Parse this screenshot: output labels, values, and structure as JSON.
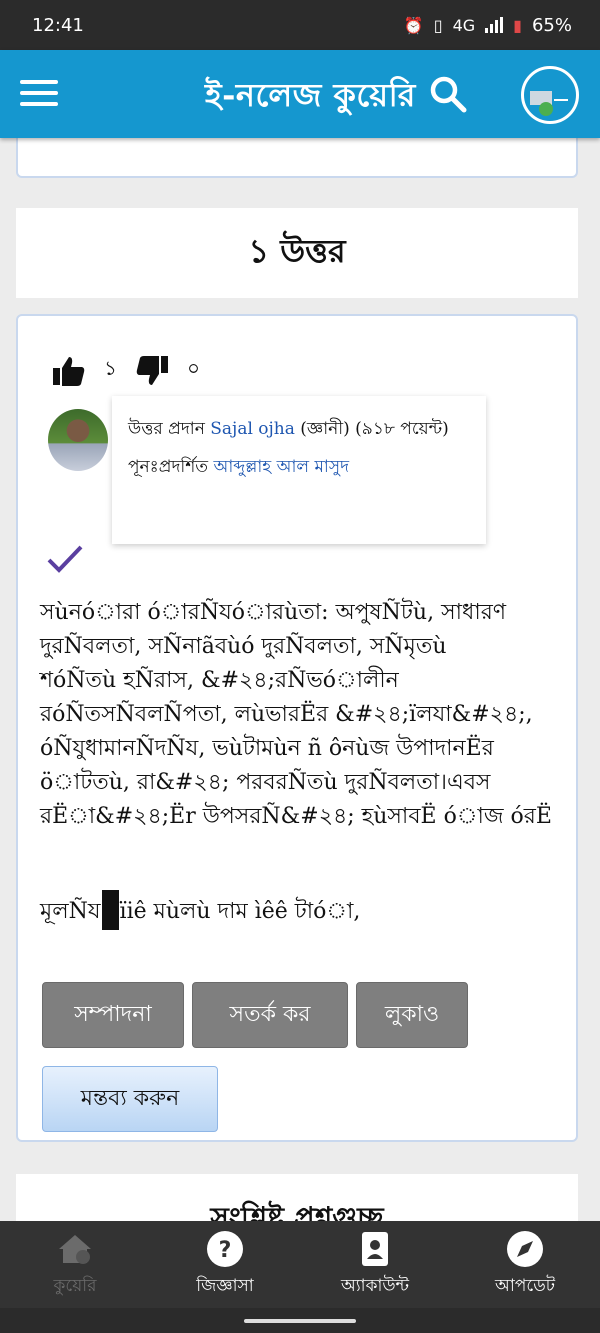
{
  "status": {
    "time": "12:41",
    "network": "4G",
    "battery": "65%"
  },
  "app_bar": {
    "title": "ই-নলেজ কুয়েরি"
  },
  "answers_heading": "১ উত্তর",
  "answer": {
    "upvotes": "১",
    "downvotes": "০",
    "answered_prefix": "উত্তর প্রদান",
    "author": "Sajal ojha",
    "author_suffix": "(জ্ঞানী) (৯১৮ পয়েন্ট)",
    "reshown_prefix": "পূনঃপ্রদর্শিত",
    "reshown_by": "আব্দুল্লাহ আল মাসুদ",
    "body_lines": [
      "সùনóারা óারÑযóারùতা: অপুষÑটù, সাধারণ",
      "দুরÑবলতা, সÑনাãবùó দুরÑবলতা, সÑমৃতù",
      "শóÑতù হÑরাস, &#২৪;রÑভóালীন",
      "রóÑতসÑবলÑপতা, লùভারËর &#২৪;ïলযা&#২৪;,",
      "óÑযুধামানÑদÑয, ভùটামùন ñ ôনùজ উপাদানËর",
      "öাটতù, রা&#২৪; পরবরÑতù দুরÑবলতা।এবস",
      "রËা&#২৪;Ër উপসরÑ&#২৪; হùসাবË óাজ óরË"
    ],
    "tail_before": "মূলÑয",
    "tail_after": "ïiê মùলù দাম ìêê টাóা,",
    "buttons": {
      "edit": "সম্পাদনা",
      "flag": "সতর্ক কর",
      "hide": "লুকাও",
      "comment": "মন্তব্য করুন"
    }
  },
  "related_heading": "সংশ্লিষ্ট প্রশ্নগুচ্ছ",
  "bottom_nav": [
    {
      "label": "কুয়েরি",
      "icon": "home-icon"
    },
    {
      "label": "জিজ্ঞাসা",
      "icon": "question-icon"
    },
    {
      "label": "অ্যাকাউন্ট",
      "icon": "account-icon"
    },
    {
      "label": "আপডেট",
      "icon": "compass-icon"
    }
  ]
}
